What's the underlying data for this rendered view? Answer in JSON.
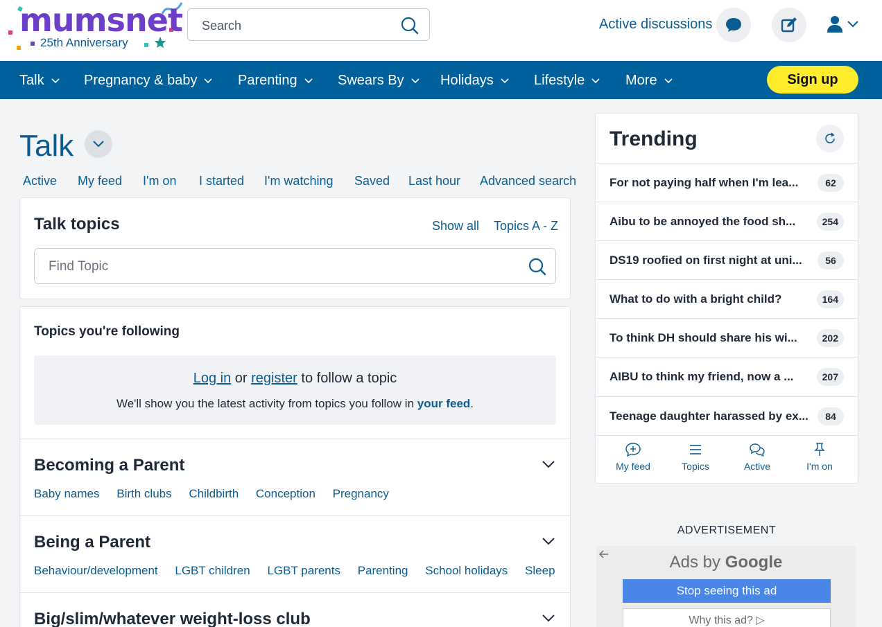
{
  "header": {
    "logo_text": "mumsnet",
    "logo_subtitle": "25th Anniversary",
    "search_placeholder": "Search",
    "active_discussions": "Active discussions"
  },
  "nav": {
    "items": [
      {
        "label": "Talk"
      },
      {
        "label": "Pregnancy & baby"
      },
      {
        "label": "Parenting"
      },
      {
        "label": "Swears By"
      },
      {
        "label": "Holidays"
      },
      {
        "label": "Lifestyle"
      },
      {
        "label": "More"
      }
    ],
    "signup": "Sign up"
  },
  "page": {
    "title": "Talk",
    "subnav": [
      "Active",
      "My feed",
      "I'm on",
      "I started",
      "I'm watching",
      "Saved",
      "Last hour",
      "Advanced search"
    ]
  },
  "talk_topics": {
    "heading": "Talk topics",
    "show_all": "Show all",
    "topics_az": "Topics A - Z",
    "find_placeholder": "Find Topic"
  },
  "following": {
    "heading": "Topics you're following",
    "login": "Log in",
    "or": "or",
    "register": "register",
    "to_follow": "to follow a topic",
    "desc_prefix": "We'll show you the latest activity from topics you follow in",
    "your_feed": "your feed",
    "desc_suffix": "."
  },
  "sections": [
    {
      "title": "Becoming a Parent",
      "links": [
        "Baby names",
        "Birth clubs",
        "Childbirth",
        "Conception",
        "Pregnancy"
      ]
    },
    {
      "title": "Being a Parent",
      "links": [
        "Behaviour/development",
        "LGBT children",
        "LGBT parents",
        "Parenting",
        "School holidays",
        "Sleep"
      ]
    },
    {
      "title": "Big/slim/whatever weight-loss club",
      "links": []
    }
  ],
  "trending": {
    "heading": "Trending",
    "items": [
      {
        "title": "For not paying half when I'm lea...",
        "count": "62"
      },
      {
        "title": "Aibu to be annoyed the food sh...",
        "count": "254"
      },
      {
        "title": "DS19 roofied on first night at uni...",
        "count": "56"
      },
      {
        "title": "What to do with a bright child?",
        "count": "164"
      },
      {
        "title": "To think DH should share his wi...",
        "count": "202"
      },
      {
        "title": "AIBU to think my friend, now a ...",
        "count": "207"
      },
      {
        "title": "Teenage daughter harassed by ex...",
        "count": "84"
      }
    ],
    "footer": [
      "My feed",
      "Topics",
      "Active",
      "I'm on"
    ]
  },
  "advert": {
    "label": "ADVERTISEMENT",
    "ads_by": "Ads by",
    "google": "Google",
    "stop": "Stop seeing this ad",
    "why": "Why this ad? ▷"
  },
  "colors": {
    "brand_blue": "#00609c",
    "link_blue": "#0b5d91",
    "signup_yellow": "#ffec2d"
  }
}
